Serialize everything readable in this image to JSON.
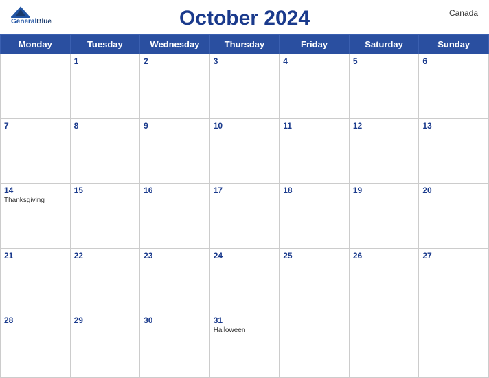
{
  "header": {
    "title": "October 2024",
    "country": "Canada",
    "logo_line1": "General",
    "logo_line2": "Blue"
  },
  "days_of_week": [
    "Monday",
    "Tuesday",
    "Wednesday",
    "Thursday",
    "Friday",
    "Saturday",
    "Sunday"
  ],
  "weeks": [
    [
      {
        "date": "",
        "event": ""
      },
      {
        "date": "1",
        "event": ""
      },
      {
        "date": "2",
        "event": ""
      },
      {
        "date": "3",
        "event": ""
      },
      {
        "date": "4",
        "event": ""
      },
      {
        "date": "5",
        "event": ""
      },
      {
        "date": "6",
        "event": ""
      }
    ],
    [
      {
        "date": "7",
        "event": ""
      },
      {
        "date": "8",
        "event": ""
      },
      {
        "date": "9",
        "event": ""
      },
      {
        "date": "10",
        "event": ""
      },
      {
        "date": "11",
        "event": ""
      },
      {
        "date": "12",
        "event": ""
      },
      {
        "date": "13",
        "event": ""
      }
    ],
    [
      {
        "date": "14",
        "event": "Thanksgiving"
      },
      {
        "date": "15",
        "event": ""
      },
      {
        "date": "16",
        "event": ""
      },
      {
        "date": "17",
        "event": ""
      },
      {
        "date": "18",
        "event": ""
      },
      {
        "date": "19",
        "event": ""
      },
      {
        "date": "20",
        "event": ""
      }
    ],
    [
      {
        "date": "21",
        "event": ""
      },
      {
        "date": "22",
        "event": ""
      },
      {
        "date": "23",
        "event": ""
      },
      {
        "date": "24",
        "event": ""
      },
      {
        "date": "25",
        "event": ""
      },
      {
        "date": "26",
        "event": ""
      },
      {
        "date": "27",
        "event": ""
      }
    ],
    [
      {
        "date": "28",
        "event": ""
      },
      {
        "date": "29",
        "event": ""
      },
      {
        "date": "30",
        "event": ""
      },
      {
        "date": "31",
        "event": "Halloween"
      },
      {
        "date": "",
        "event": ""
      },
      {
        "date": "",
        "event": ""
      },
      {
        "date": "",
        "event": ""
      }
    ]
  ],
  "accent_color": "#2a4fa0"
}
